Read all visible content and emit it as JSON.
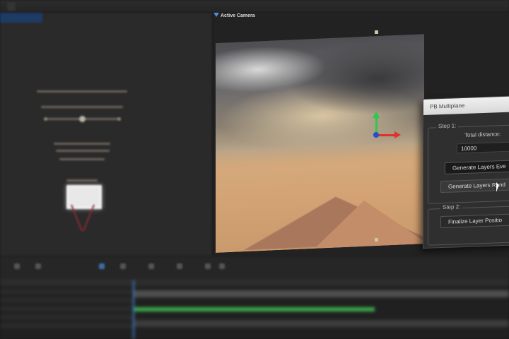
{
  "topbar": {
    "tab_comp": "",
    "tab_x": "",
    "tab_right": ""
  },
  "left_panel": {
    "tab_label": ""
  },
  "viewer": {
    "title": "Active Camera"
  },
  "dialog": {
    "title": "PB Multiplane",
    "step1_label": "Step 1:",
    "total_distance_label": "Total distance:",
    "total_distance_value": "10000",
    "generate_evenly_label": "Generate Layers Eve",
    "generate_random_label": "Generate Layers Rand",
    "step2_label": "Step 2:",
    "finalize_label": "Finalize Layer Positio"
  },
  "colors": {
    "gizmo_y": "#2ec84a",
    "gizmo_x": "#e03030",
    "gizmo_center": "#2050d0",
    "timeline_bar": "#3aa94a",
    "playhead": "#3a7bd5"
  },
  "icons": [
    "move-gizmo-icon",
    "cursor-icon"
  ]
}
